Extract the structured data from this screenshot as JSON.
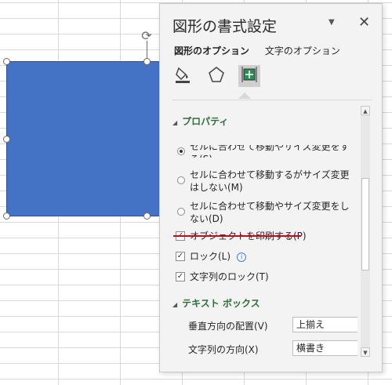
{
  "panel": {
    "title": "図形の書式設定",
    "dropdown_glyph": "▼",
    "close_glyph": "✕",
    "tabs": [
      "図形のオプション",
      "文字のオプション"
    ],
    "icons": [
      "fill-line-icon",
      "effects-icon",
      "size-properties-icon"
    ]
  },
  "properties": {
    "header": "プロパティ",
    "options": [
      {
        "label": "セルに合わせて移動やサイズ変更をする(S)",
        "type": "radio",
        "checked": true
      },
      {
        "label": "セルに合わせて移動するがサイズ変更はしない(M)",
        "type": "radio",
        "checked": false
      },
      {
        "label": "セルに合わせて移動やサイズ変更をしない(D)",
        "type": "radio",
        "checked": false
      },
      {
        "label": "オブジェクトを印刷する(P)",
        "type": "checkbox",
        "checked": true
      },
      {
        "label": "ロック(L)",
        "type": "checkbox",
        "checked": true
      },
      {
        "label": "文字列のロック(T)",
        "type": "checkbox",
        "checked": true
      }
    ],
    "info_glyph": "i"
  },
  "textbox": {
    "header": "テキスト ボックス",
    "vertical_label": "垂直方向の配置(V)",
    "vertical_value": "上揃え",
    "direction_label": "文字列の方向(X)",
    "direction_value": "横書き"
  },
  "colors": {
    "shape_fill": "#4472c4",
    "section_header": "#2e6e3a",
    "annotation_underline": "#d0021b"
  }
}
